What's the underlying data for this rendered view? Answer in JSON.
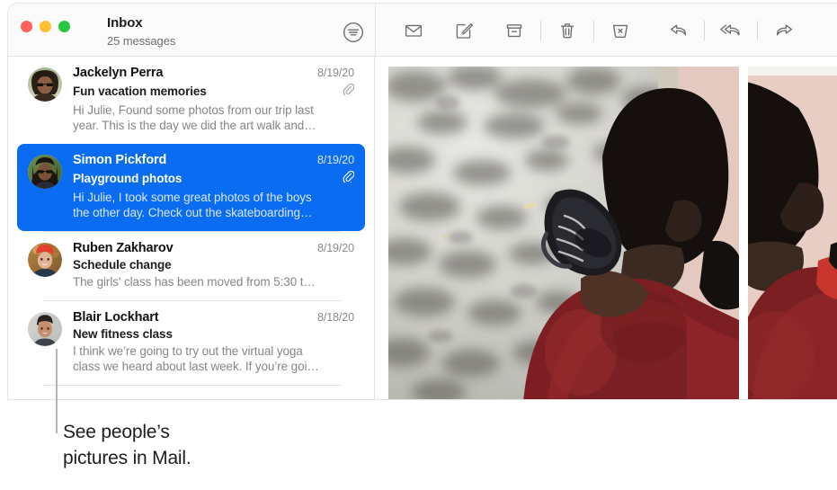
{
  "window": {
    "traffic_lights": [
      {
        "name": "close",
        "color": "#ff6159"
      },
      {
        "name": "minimize",
        "color": "#ffbe2f"
      },
      {
        "name": "zoom",
        "color": "#2ac840"
      }
    ],
    "mailbox_title": "Inbox",
    "message_count_label": "25 messages",
    "sort_icon": "sort-filter-icon"
  },
  "toolbar": {
    "buttons": [
      {
        "name": "get-mail-button",
        "icon": "envelope-icon",
        "label": "Get Mail"
      },
      {
        "name": "compose-button",
        "icon": "compose-icon",
        "label": "New Message"
      },
      {
        "name": "archive-button",
        "icon": "archive-icon",
        "label": "Archive"
      },
      {
        "name": "delete-button",
        "icon": "trash-icon",
        "label": "Delete"
      },
      {
        "name": "junk-button",
        "icon": "junk-icon",
        "label": "Move to Junk"
      },
      {
        "name": "reply-button",
        "icon": "reply-icon",
        "label": "Reply"
      },
      {
        "name": "reply-all-button",
        "icon": "reply-all-icon",
        "label": "Reply All"
      },
      {
        "name": "forward-button",
        "icon": "forward-icon",
        "label": "Forward"
      }
    ]
  },
  "messages": [
    {
      "sender": "Jackelyn Perra",
      "date": "8/19/20",
      "subject": "Fun vacation memories",
      "preview": "Hi Julie, Found some photos from our trip last\nyear. This is the day we did the art walk and…",
      "has_attachment": true,
      "selected": false,
      "avatar": "woman-sunglasses-avatar"
    },
    {
      "sender": "Simon Pickford",
      "date": "8/19/20",
      "subject": "Playground photos",
      "preview": "Hi Julie, I took some great photos of the boys\nthe other day. Check out the skateboarding…",
      "has_attachment": true,
      "selected": true,
      "avatar": "man-dreadlocks-avatar"
    },
    {
      "sender": "Ruben Zakharov",
      "date": "8/19/20",
      "subject": "Schedule change",
      "preview": "The girls' class has been moved from 5:30 t…",
      "has_attachment": false,
      "selected": false,
      "avatar": "man-red-beanie-avatar"
    },
    {
      "sender": "Blair Lockhart",
      "date": "8/18/20",
      "subject": "New fitness class",
      "preview": "I think we’re going to try out the virtual yoga\nclass we heard about last week. If you’re goi…",
      "has_attachment": false,
      "selected": false,
      "avatar": "woman-short-hair-avatar"
    }
  ],
  "preview": {
    "photos": [
      {
        "name": "photo-boy-red-shirt",
        "alt": "Person in red shirt seen from behind on dappled pavement"
      },
      {
        "name": "photo-second-partial",
        "alt": "Partially visible second photo with pink background"
      }
    ]
  },
  "callout": {
    "text": "See people’s\npictures in Mail.",
    "line_color": "#b4b4b4"
  },
  "colors": {
    "selection_blue": "#0a6cf1",
    "toolbar_icon": "#6e6e73",
    "text_primary": "#1d1d1f",
    "text_secondary": "#86868b"
  }
}
